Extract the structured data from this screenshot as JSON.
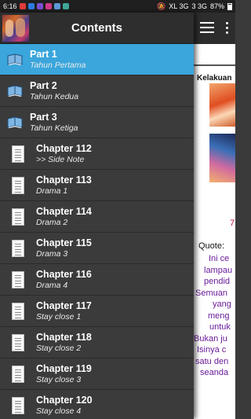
{
  "status": {
    "time": "6:16",
    "network": "XL 3G",
    "network2": "3 3G",
    "battery": "87%"
  },
  "drawer": {
    "title": "Contents",
    "items": [
      {
        "title": "Part 1",
        "subtitle": "Tahun Pertama",
        "type": "part",
        "active": true
      },
      {
        "title": "Part 2",
        "subtitle": "Tahun Kedua",
        "type": "part",
        "active": false
      },
      {
        "title": "Part 3",
        "subtitle": "Tahun Ketiga",
        "type": "part",
        "active": false
      },
      {
        "title": "Chapter 112",
        "subtitle": ">> Side Note",
        "type": "chapter",
        "active": false
      },
      {
        "title": "Chapter 113",
        "subtitle": "Drama 1",
        "type": "chapter",
        "active": false
      },
      {
        "title": "Chapter 114",
        "subtitle": "Drama 2",
        "type": "chapter",
        "active": false
      },
      {
        "title": "Chapter 115",
        "subtitle": "Drama 3",
        "type": "chapter",
        "active": false
      },
      {
        "title": "Chapter 116",
        "subtitle": "Drama 4",
        "type": "chapter",
        "active": false
      },
      {
        "title": "Chapter 117",
        "subtitle": "Stay close 1",
        "type": "chapter",
        "active": false
      },
      {
        "title": "Chapter 118",
        "subtitle": "Stay close 2",
        "type": "chapter",
        "active": false
      },
      {
        "title": "Chapter 119",
        "subtitle": "Stay close 3",
        "type": "chapter",
        "active": false
      },
      {
        "title": "Chapter 120",
        "subtitle": "Stay close 4",
        "type": "chapter",
        "active": false
      }
    ]
  },
  "content": {
    "heading": "Kelakuan",
    "red_text": "7",
    "quote_label": "Quote:",
    "quote_lines": [
      "Ini ce",
      "lampau",
      "pendid",
      "Semuan",
      "yang",
      "meng",
      "untuk",
      "Bukan ju",
      "Isinya c",
      "satu den",
      "seanda"
    ]
  },
  "colors": {
    "accent": "#3aa6dc",
    "drawer_bg": "#3b3b3b",
    "header_bg": "#2e2e2e",
    "quote_text": "#6a1b9a",
    "highlight_red": "#c0143c"
  },
  "icons": {
    "menu": "hamburger-icon",
    "overflow": "more-vert-icon",
    "part": "book-icon",
    "chapter": "document-icon"
  }
}
